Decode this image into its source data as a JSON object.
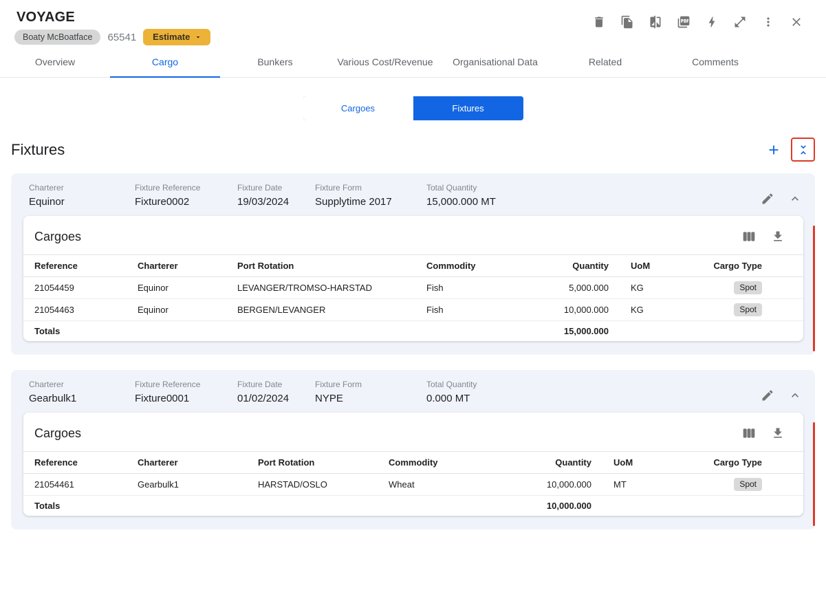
{
  "colors": {
    "accent_blue": "#1266e3",
    "estimate_amber": "#ecb338",
    "alert_red": "#dc3b2a",
    "card_bg": "#f0f4fa"
  },
  "header": {
    "title": "VOYAGE",
    "vessel_chip": "Boaty McBoatface",
    "voyage_number": "65541",
    "estimate_button": "Estimate",
    "toolbar_icons": [
      "delete",
      "duplicate",
      "compare",
      "export-pdf",
      "quick-actions",
      "expand",
      "more-options",
      "close"
    ]
  },
  "tabs": [
    {
      "label": "Overview"
    },
    {
      "label": "Cargo"
    },
    {
      "label": "Bunkers"
    },
    {
      "label": "Various Cost/Revenue"
    },
    {
      "label": "Organisational Data"
    },
    {
      "label": "Related"
    },
    {
      "label": "Comments"
    }
  ],
  "active_tab": "Cargo",
  "view_toggle": {
    "cargoes_label": "Cargoes",
    "fixtures_label": "Fixtures",
    "active": "Fixtures"
  },
  "section": {
    "title": "Fixtures"
  },
  "fixture_field_labels": {
    "charterer": "Charterer",
    "reference": "Fixture Reference",
    "date": "Fixture Date",
    "form": "Fixture Form",
    "total_quantity": "Total Quantity"
  },
  "cargo_table": {
    "columns": [
      "Reference",
      "Charterer",
      "Port Rotation",
      "Commodity",
      "Quantity",
      "UoM",
      "Cargo Type"
    ]
  },
  "fixtures": [
    {
      "charterer": "Equinor",
      "reference": "Fixture0002",
      "date": "19/03/2024",
      "form": "Supplytime 2017",
      "total_quantity": "15,000.000 MT",
      "cargoes": {
        "title": "Cargoes",
        "rows": [
          {
            "reference": "21054459",
            "charterer": "Equinor",
            "port_rotation": "LEVANGER/TROMSO-HARSTAD",
            "commodity": "Fish",
            "quantity": "5,000.000",
            "uom": "KG",
            "cargo_type": "Spot"
          },
          {
            "reference": "21054463",
            "charterer": "Equinor",
            "port_rotation": "BERGEN/LEVANGER",
            "commodity": "Fish",
            "quantity": "10,000.000",
            "uom": "KG",
            "cargo_type": "Spot"
          }
        ],
        "totals_label": "Totals",
        "totals_quantity": "15,000.000"
      }
    },
    {
      "charterer": "Gearbulk1",
      "reference": "Fixture0001",
      "date": "01/02/2024",
      "form": "NYPE",
      "total_quantity": "0.000 MT",
      "cargoes": {
        "title": "Cargoes",
        "rows": [
          {
            "reference": "21054461",
            "charterer": "Gearbulk1",
            "port_rotation": "HARSTAD/OSLO",
            "commodity": "Wheat",
            "quantity": "10,000.000",
            "uom": "MT",
            "cargo_type": "Spot"
          }
        ],
        "totals_label": "Totals",
        "totals_quantity": "10,000.000"
      }
    }
  ]
}
